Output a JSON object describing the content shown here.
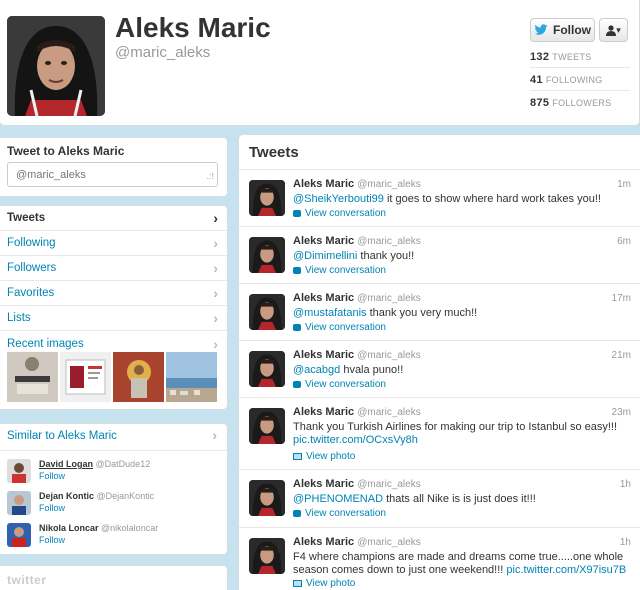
{
  "profile": {
    "name": "Aleks Maric",
    "handle": "@maric_aleks",
    "follow_label": "Follow",
    "user_menu_label": "▾",
    "stats": [
      {
        "count": "132",
        "label": "TWEETS"
      },
      {
        "count": "41",
        "label": "FOLLOWING"
      },
      {
        "count": "875",
        "label": "FOLLOWERS"
      }
    ]
  },
  "tweet_box": {
    "title": "Tweet to Aleks Maric",
    "value": "@maric_aleks"
  },
  "nav": {
    "items": [
      {
        "label": "Tweets"
      },
      {
        "label": "Following"
      },
      {
        "label": "Followers"
      },
      {
        "label": "Favorites"
      },
      {
        "label": "Lists"
      },
      {
        "label": "Recent images"
      }
    ]
  },
  "similar": {
    "title": "Similar to Aleks Maric",
    "users": [
      {
        "name": "David Logan",
        "handle": "@DatDude12",
        "follow": "Follow"
      },
      {
        "name": "Dejan Kontic",
        "handle": "@DejanKontic",
        "follow": "Follow"
      },
      {
        "name": "Nikola Loncar",
        "handle": "@nikolaloncar",
        "follow": "Follow"
      }
    ]
  },
  "footer": {
    "logo": "twitter"
  },
  "stream": {
    "title": "Tweets",
    "tweets": [
      {
        "name": "Aleks Maric",
        "handle": "@maric_aleks",
        "time": "1m",
        "mention": "@SheikYerbouti99",
        "text": " it goes to show where hard work takes you!!",
        "action": "View conversation",
        "action_icon": "conversation-icon"
      },
      {
        "name": "Aleks Maric",
        "handle": "@maric_aleks",
        "time": "6m",
        "mention": "@Dimimellini",
        "text": " thank you!!",
        "action": "View conversation",
        "action_icon": "conversation-icon"
      },
      {
        "name": "Aleks Maric",
        "handle": "@maric_aleks",
        "time": "17m",
        "mention": "@mustafatanis",
        "text": " thank you very much!!",
        "action": "View conversation",
        "action_icon": "conversation-icon"
      },
      {
        "name": "Aleks Maric",
        "handle": "@maric_aleks",
        "time": "21m",
        "mention": "@acabgd",
        "text": " hvala puno!!",
        "action": "View conversation",
        "action_icon": "conversation-icon"
      },
      {
        "name": "Aleks Maric",
        "handle": "@maric_aleks",
        "time": "23m",
        "text": "Thank you Turkish Airlines for making our trip to Istanbul so easy!!!",
        "link": "pic.twitter.com/OCxsVy8h",
        "action": "View photo",
        "action_icon": "photo-icon"
      },
      {
        "name": "Aleks Maric",
        "handle": "@maric_aleks",
        "time": "1h",
        "mention": "@PHENOMENAD",
        "text": " thats all Nike is is just does it!!!",
        "action": "View conversation",
        "action_icon": "conversation-icon"
      },
      {
        "name": "Aleks Maric",
        "handle": "@maric_aleks",
        "time": "1h",
        "text": "F4 where champions are made and dreams come true.....one whole season comes down to just one weekend!!!",
        "link": "pic.twitter.com/X97isu7B",
        "action": "View photo",
        "action_icon": "photo-icon"
      }
    ]
  },
  "colors": {
    "background": "#c6e2ee",
    "link": "#0084b4",
    "text": "#333333",
    "muted": "#999999",
    "twitter_blue": "#2ea7e0"
  }
}
